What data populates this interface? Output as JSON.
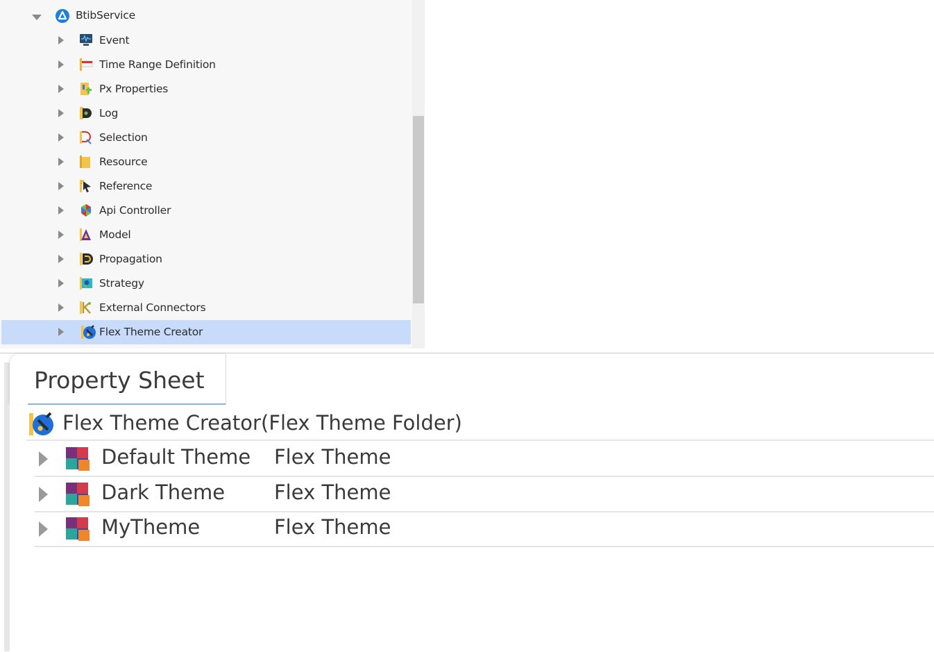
{
  "tree": {
    "root": {
      "label": "BtibService",
      "icon": "btib-service-icon"
    },
    "items": [
      {
        "label": "Event",
        "icon": "event-monitor-icon"
      },
      {
        "label": "Time Range Definition",
        "icon": "time-range-flag-icon"
      },
      {
        "label": "Px Properties",
        "icon": "px-properties-icon"
      },
      {
        "label": "Log",
        "icon": "log-icon"
      },
      {
        "label": "Selection",
        "icon": "selection-icon"
      },
      {
        "label": "Resource",
        "icon": "resource-icon"
      },
      {
        "label": "Reference",
        "icon": "reference-icon"
      },
      {
        "label": "Api Controller",
        "icon": "api-controller-icon"
      },
      {
        "label": "Model",
        "icon": "model-icon"
      },
      {
        "label": "Propagation",
        "icon": "propagation-icon"
      },
      {
        "label": "Strategy",
        "icon": "strategy-icon"
      },
      {
        "label": "External Connectors",
        "icon": "external-connectors-icon"
      },
      {
        "label": "Flex Theme Creator",
        "icon": "flex-theme-creator-icon",
        "selected": true
      }
    ]
  },
  "property_sheet": {
    "tab_label": "Property Sheet",
    "header": {
      "title": "Flex Theme Creator",
      "type": "(Flex Theme Folder)",
      "icon": "flex-theme-creator-icon"
    },
    "rows": [
      {
        "name": "Default Theme",
        "value": "Flex Theme",
        "icon": "flex-theme-icon"
      },
      {
        "name": "Dark Theme",
        "value": "Flex Theme",
        "icon": "flex-theme-icon"
      },
      {
        "name": "MyTheme",
        "value": "Flex Theme",
        "icon": "flex-theme-icon"
      }
    ]
  },
  "colors": {
    "selection": "#c8dbfb",
    "tab_underline": "#8fb3e8",
    "text": "#3a3a3a"
  }
}
